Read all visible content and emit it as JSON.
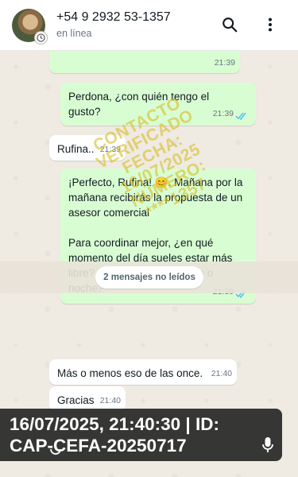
{
  "header": {
    "contact_name": "+54 9 2932 53-1357",
    "status": "en línea",
    "icons": [
      "avatar",
      "clock-icon",
      "search-icon",
      "more-vert-icon"
    ]
  },
  "messages": [
    {
      "direction": "out",
      "text": "",
      "time": "21:39"
    },
    {
      "direction": "out",
      "text": "Perdona, ¿con quién tengo el gusto?",
      "time": "21:39",
      "read": true
    },
    {
      "direction": "in",
      "text": "Rufina..",
      "time": "21:39"
    },
    {
      "direction": "out",
      "text": "¡Perfecto, Rufina! 😊. Mañana por la mañana recibirás la propuesta de un asesor comercial\n\nPara coordinar mejor, ¿en qué momento del día sueles estar más libre? ¿Por la mañana, tarde o noche?",
      "time": "21:39",
      "read": true
    },
    {
      "direction": "in",
      "text": "Más o menos eso de las once.",
      "time": "21:40"
    },
    {
      "direction": "in",
      "text": "Gracias",
      "time": "21:40"
    }
  ],
  "unread_label": "2 mensajes no leídos",
  "stamp": {
    "lines": [
      "CONTACTO",
      "VERIFICADO",
      "FECHA:",
      "16/07/2025",
      "NÚMERO:",
      "****1357"
    ],
    "color": "#d7be28"
  },
  "banner": {
    "line1": "16/07/2025, 21:40:30 | ID:",
    "line2": "CAP-CEFA-20250717"
  },
  "colors": {
    "outgoing_bubble": "#d9fdd3",
    "incoming_bubble": "#ffffff",
    "chat_background": "#efeae2",
    "read_ticks": "#53bdeb"
  }
}
